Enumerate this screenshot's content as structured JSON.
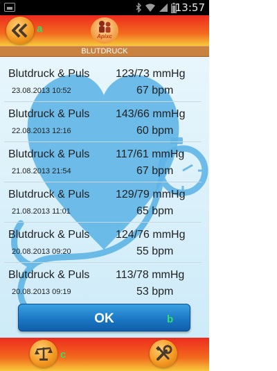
{
  "status": {
    "time": "13:57"
  },
  "header": {
    "logo_text": "Apixc",
    "annotation": "a"
  },
  "section": {
    "title": "BLUTDRUCK"
  },
  "rows": [
    {
      "title": "Blutdruck & Puls",
      "date": "23.08.2013 10:52",
      "bp": "123/73 mmHg",
      "pulse": "67 bpm"
    },
    {
      "title": "Blutdruck & Puls",
      "date": "22.08.2013 12:16",
      "bp": "143/66 mmHg",
      "pulse": "60 bpm"
    },
    {
      "title": "Blutdruck & Puls",
      "date": "21.08.2013 21:54",
      "bp": "117/61 mmHg",
      "pulse": "67 bpm"
    },
    {
      "title": "Blutdruck & Puls",
      "date": "21.08.2013 11:01",
      "bp": "129/79 mmHg",
      "pulse": "65 bpm"
    },
    {
      "title": "Blutdruck & Puls",
      "date": "20.08.2013 09:20",
      "bp": "124/76 mmHg",
      "pulse": "55 bpm"
    },
    {
      "title": "Blutdruck & Puls",
      "date": "20.08.2013 09:19",
      "bp": "113/78 mmHg",
      "pulse": "53 bpm"
    }
  ],
  "ok_button": {
    "label": "OK",
    "annotation": "b"
  },
  "footer": {
    "annotation": "c"
  },
  "colors": {
    "accent_red": "#ee2b1f",
    "accent_orange": "#f7c83a",
    "section_bar": "#c9823f",
    "ok_blue": "#1c78c5",
    "art_blue": "#54b2e8",
    "annotation_green": "#35e06a"
  },
  "icons": {
    "back": "double-chevron-left-icon",
    "scale": "balance-scale-icon",
    "tools": "wrench-screwdriver-icon"
  }
}
